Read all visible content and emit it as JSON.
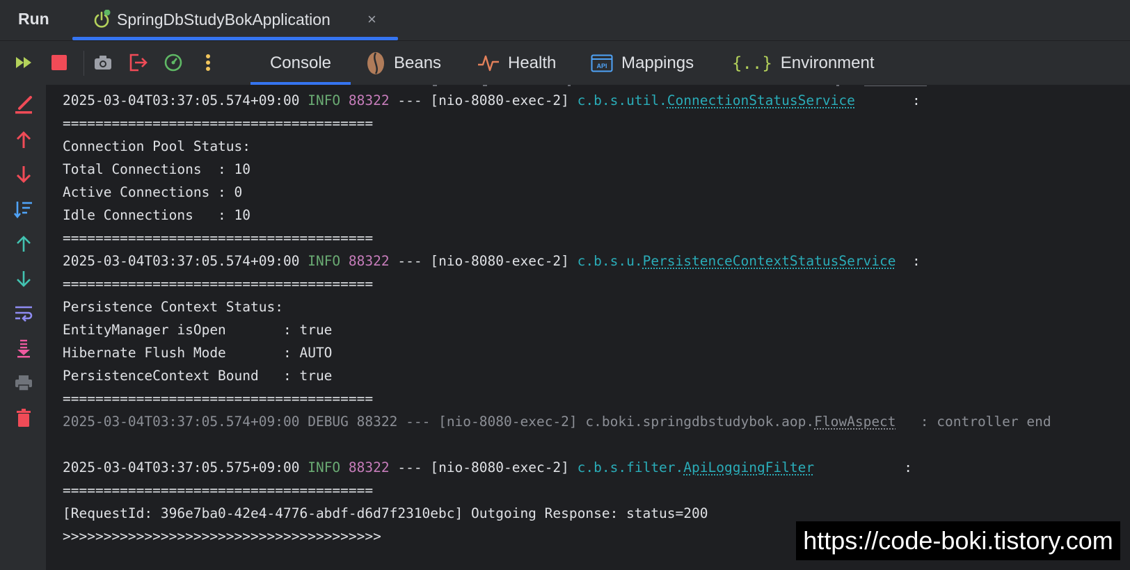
{
  "runbar": {
    "title": "Run",
    "app_tab": {
      "label": "SpringDbStudyBokApplication",
      "close": "×"
    }
  },
  "toolbar": {
    "tools": [
      "rerun-icon",
      "stop-icon",
      "camera-icon",
      "exit-icon",
      "profiler-icon",
      "more-icon"
    ],
    "tabs": [
      {
        "label": "Console",
        "icon": "console",
        "active": true
      },
      {
        "label": "Beans",
        "icon": "bean-icon"
      },
      {
        "label": "Health",
        "icon": "pulse-icon"
      },
      {
        "label": "Mappings",
        "icon": "api-icon"
      },
      {
        "label": "Environment",
        "icon": "braces-icon"
      }
    ],
    "colors": {
      "accent": "#3574f0",
      "stop": "#f04b57",
      "rerun": "#b4d25b"
    }
  },
  "gutter": {
    "icons": [
      "clear-icon",
      "scroll-up-red-icon",
      "scroll-down-red-icon",
      "sort-icon",
      "up-arrow-icon",
      "down-arrow-icon",
      "soft-wrap-icon",
      "scroll-to-end-icon",
      "print-icon",
      "trash-icon"
    ]
  },
  "console": {
    "lines": [
      {
        "type": "log",
        "ts": "2025-03-04T03:37:05.574+09:00",
        "level": " INFO",
        "pid": "88322",
        "sep": " --- ",
        "thread": "[nio-8080-exec-2] ",
        "pkg": "c.b.s.util.",
        "cls": "ConnectionStatusService",
        "tail": "       :"
      },
      {
        "type": "text",
        "text": "======================================"
      },
      {
        "type": "text",
        "text": "Connection Pool Status:"
      },
      {
        "type": "text",
        "text": "Total Connections  : 10"
      },
      {
        "type": "text",
        "text": "Active Connections : 0"
      },
      {
        "type": "text",
        "text": "Idle Connections   : 10"
      },
      {
        "type": "text",
        "text": "======================================"
      },
      {
        "type": "log",
        "ts": "2025-03-04T03:37:05.574+09:00",
        "level": " INFO",
        "pid": "88322",
        "sep": " --- ",
        "thread": "[nio-8080-exec-2] ",
        "pkg": "c.b.s.u.",
        "cls": "PersistenceContextStatusService",
        "tail": "  :"
      },
      {
        "type": "text",
        "text": "======================================"
      },
      {
        "type": "text",
        "text": "Persistence Context Status:"
      },
      {
        "type": "text",
        "text": "EntityManager isOpen       : true"
      },
      {
        "type": "text",
        "text": "Hibernate Flush Mode       : AUTO"
      },
      {
        "type": "text",
        "text": "PersistenceContext Bound   : true"
      },
      {
        "type": "text",
        "text": "======================================"
      },
      {
        "type": "debug",
        "ts": "2025-03-04T03:37:05.574+09:00",
        "level": " DEBUG",
        "pid": "88322",
        "thread": " --- [nio-8080-exec-2] ",
        "pkg": "c.boki.springdbstudybok.aop.",
        "cls": "FlowAspect",
        "tail": "   : controller end"
      },
      {
        "type": "text",
        "text": ""
      },
      {
        "type": "log",
        "ts": "2025-03-04T03:37:05.575+09:00",
        "level": " INFO",
        "pid": "88322",
        "sep": " --- ",
        "thread": "[nio-8080-exec-2] ",
        "pkg": "c.b.s.filter.",
        "cls": "ApiLoggingFilter",
        "tail": "           :"
      },
      {
        "type": "text",
        "text": "======================================"
      },
      {
        "type": "text",
        "text": "[RequestId: 396e7ba0-42e4-4776-abdf-d6d7f2310ebc] Outgoing Response: status=200"
      },
      {
        "type": "text",
        "text": ">>>>>>>>>>>>>>>>>>>>>>>>>>>>>>>>>>>>>>>"
      }
    ]
  },
  "watermark": {
    "text": "https://code-boki.tistory.com"
  }
}
